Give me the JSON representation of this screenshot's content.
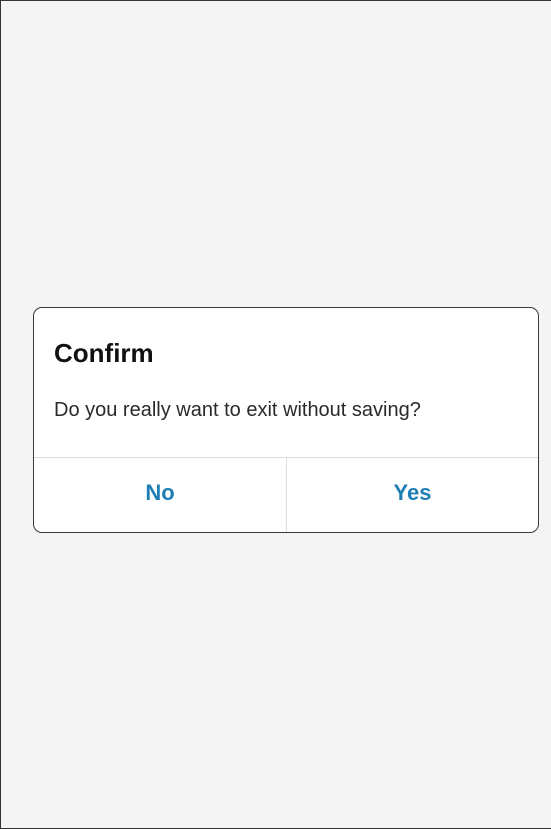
{
  "dialog": {
    "title": "Confirm",
    "message": "Do you really want to exit without saving?",
    "buttons": {
      "no_label": "No",
      "yes_label": "Yes"
    }
  },
  "colors": {
    "background": "#f4f4f4",
    "dialog_background": "#ffffff",
    "button_text": "#1f7fb5",
    "divider": "#dcdcdc"
  }
}
